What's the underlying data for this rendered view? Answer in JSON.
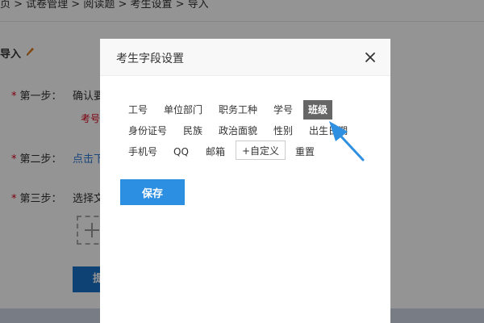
{
  "breadcrumb": "页 > 试卷管理 > 阅读题 > 考生设置 > 导入",
  "section_title": "导入",
  "steps": [
    {
      "star": "*",
      "label": "第一步：",
      "text": "确认要"
    },
    {
      "star": "*",
      "label": "第二步：",
      "text": "点击下"
    },
    {
      "star": "*",
      "label": "第三步：",
      "text": "选择文"
    }
  ],
  "step1_note": "考号",
  "submit_stub": "提",
  "dialog": {
    "title": "考生字段设置",
    "fields_row1": [
      "工号",
      "单位部门",
      "职务工种",
      "学号",
      "班级"
    ],
    "fields_row2": [
      "身份证号",
      "民族",
      "政治面貌",
      "性别",
      "出生日期"
    ],
    "fields_row3": [
      "手机号",
      "QQ",
      "邮箱",
      "+自定义",
      "重置"
    ],
    "save_label": "保存"
  },
  "colors": {
    "accent": "#2d8fe2",
    "active_tag": "#666666",
    "arrow": "#2f8fe0"
  }
}
